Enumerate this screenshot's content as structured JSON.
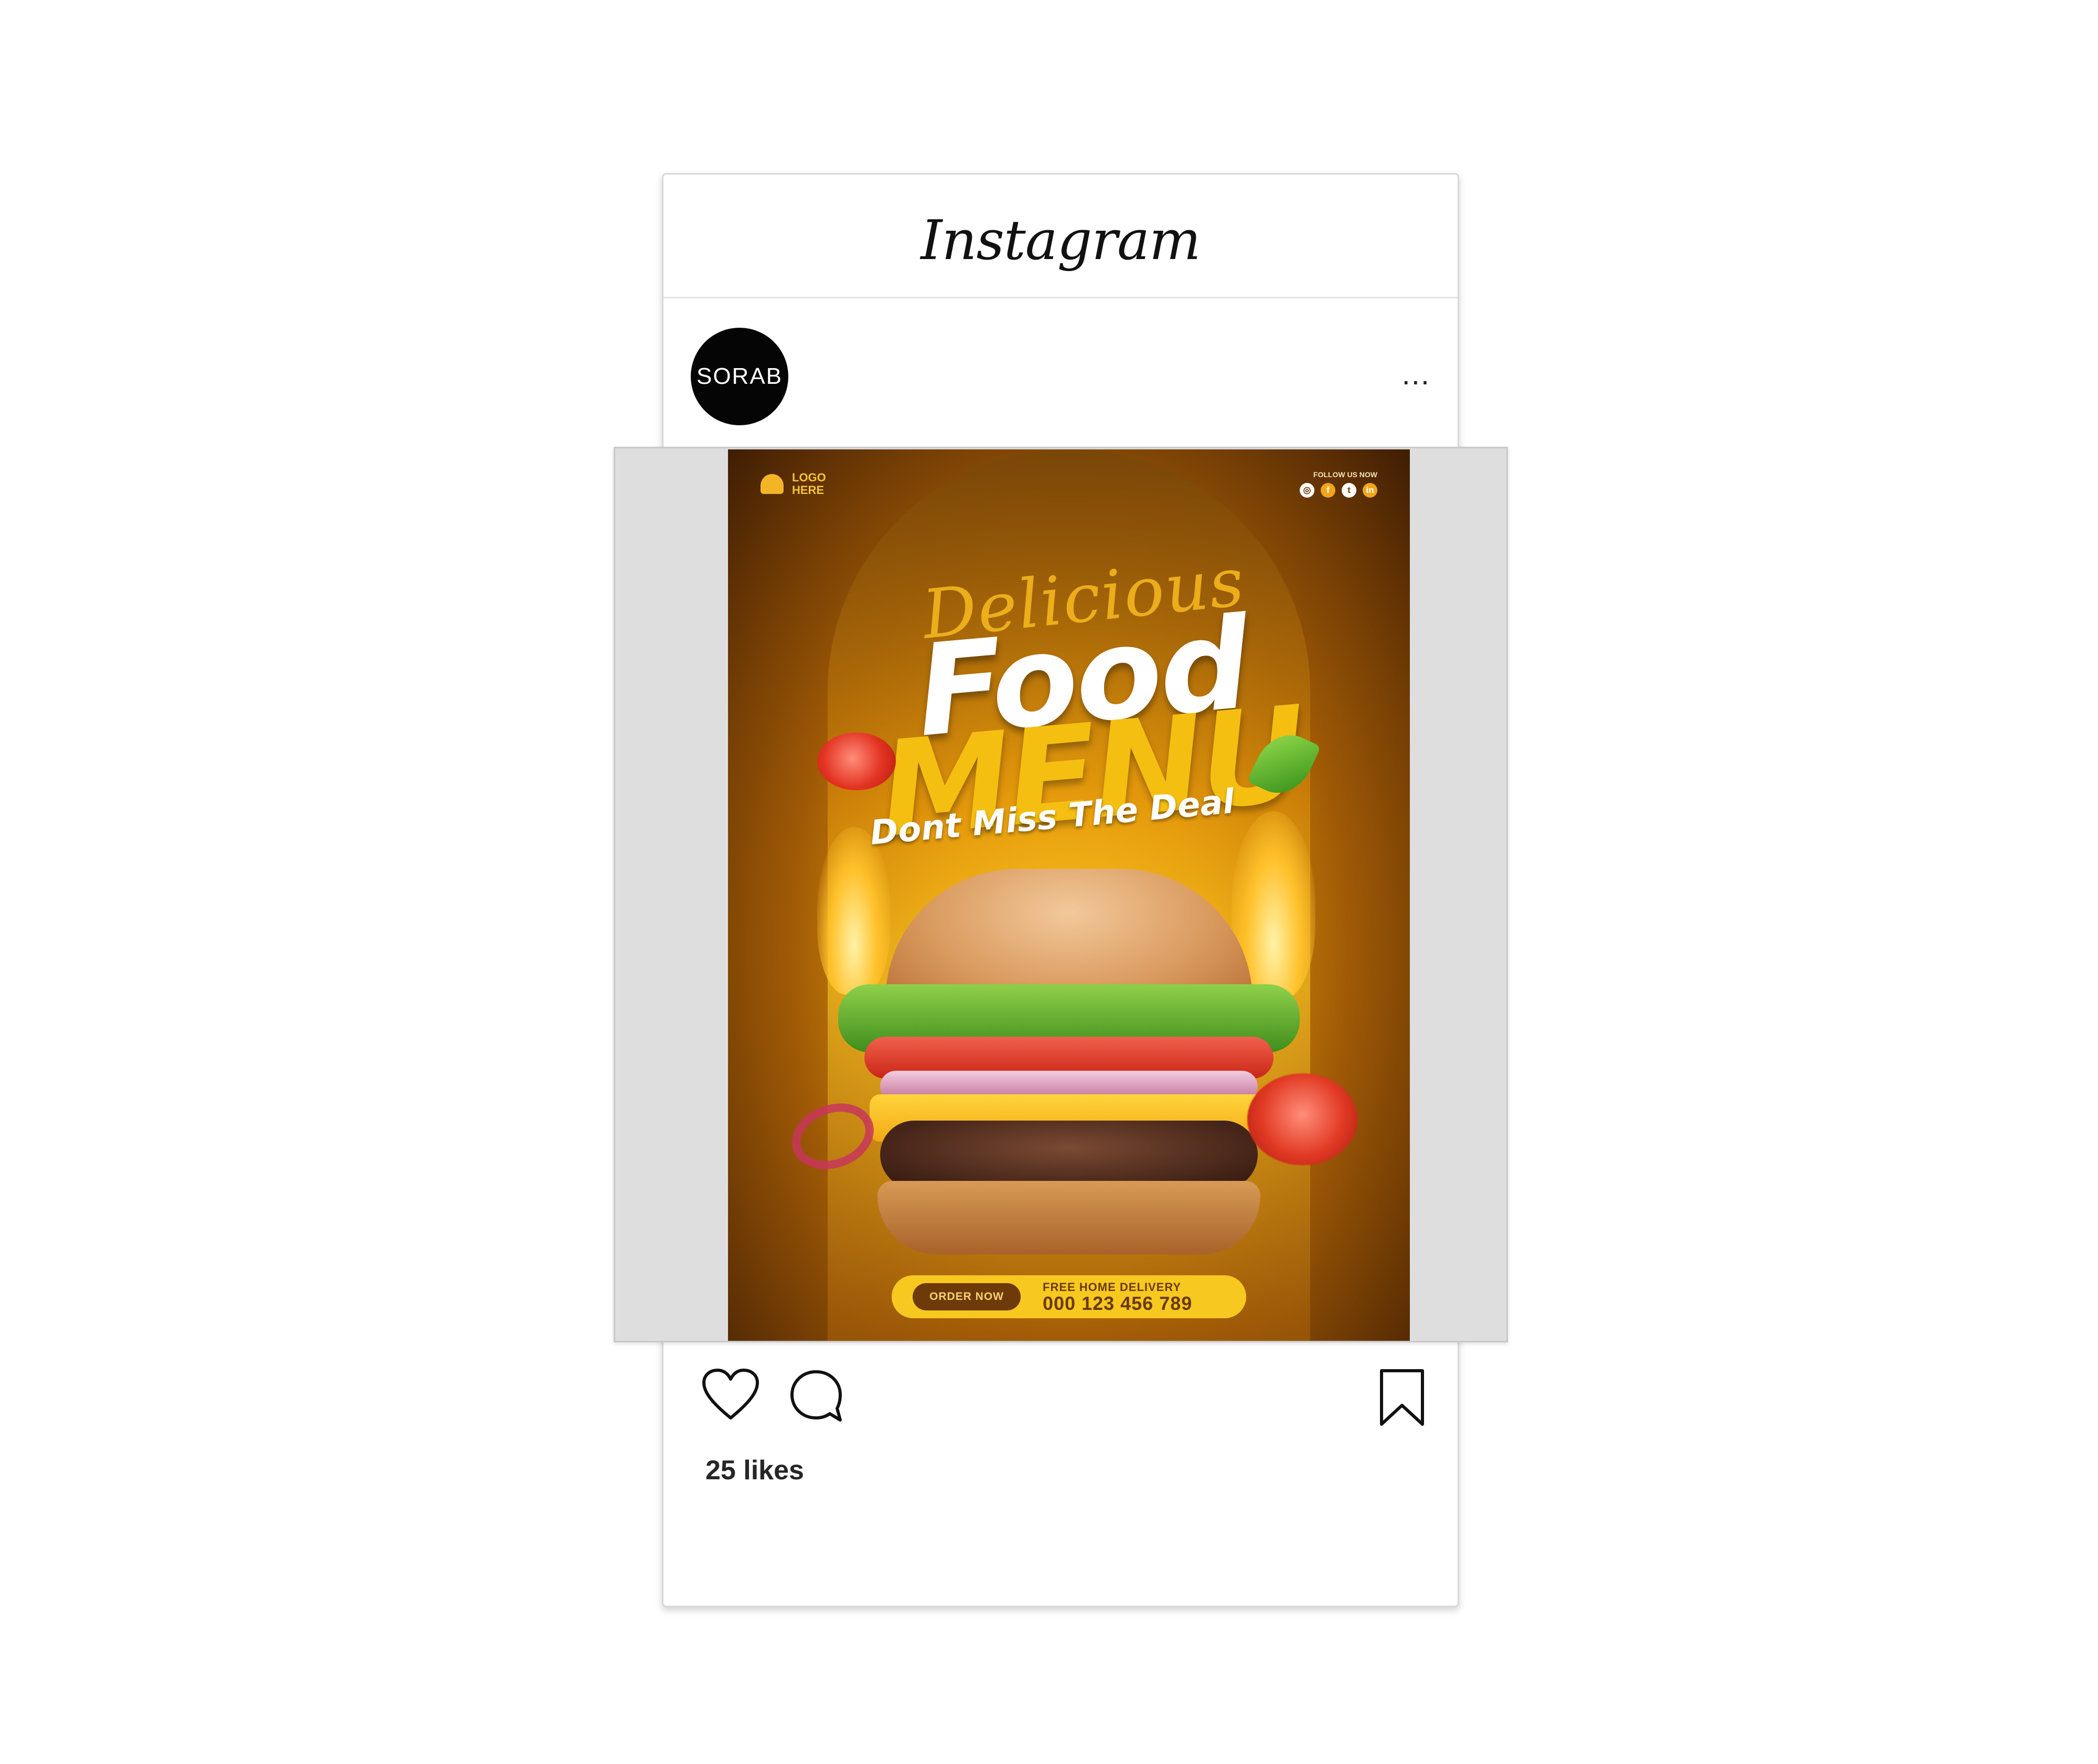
{
  "app": {
    "title": "Instagram"
  },
  "post": {
    "account": {
      "avatar_text": "SORAB"
    },
    "more_label": "...",
    "likes_text": "25 likes"
  },
  "poster": {
    "logo": "LOGO HERE",
    "follow_label": "FOLLOW US NOW",
    "social_icons": [
      {
        "name": "instagram-icon",
        "glyph": "◎"
      },
      {
        "name": "facebook-icon",
        "glyph": "f"
      },
      {
        "name": "twitter-icon",
        "glyph": "t"
      },
      {
        "name": "linkedin-icon",
        "glyph": "in"
      }
    ],
    "script_title": "Delicious",
    "title_line1": "Food",
    "title_line2": "MENU",
    "tagline": "Dont Miss The Deal",
    "cta_button": "ORDER NOW",
    "delivery_label": "FREE HOME DELIVERY",
    "delivery_phone": "000 123 456 789"
  },
  "actions": {
    "like_icon": "heart-icon",
    "comment_icon": "comment-icon",
    "save_icon": "bookmark-icon"
  },
  "colors": {
    "poster_accent": "#f5bf11",
    "poster_brown": "#6e3a0a",
    "background": "#ffffff"
  }
}
